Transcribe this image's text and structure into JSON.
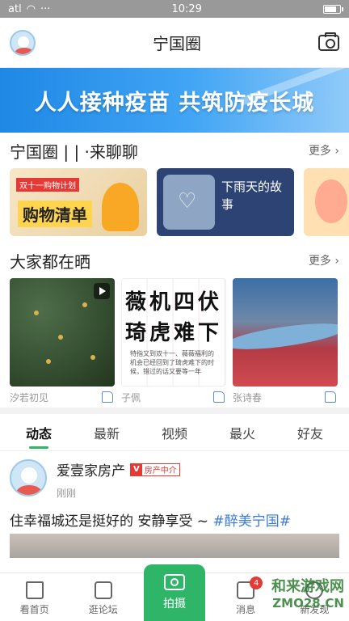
{
  "status_bar": {
    "time": "10:29",
    "signal": "atl",
    "wifi": "wifi-icon",
    "dots": "···"
  },
  "header": {
    "title": "宁国圈",
    "avatar_icon": "avatar-icon",
    "camera_icon": "camera-icon"
  },
  "banner": {
    "text": "人人接种疫苗  共筑防疫长城"
  },
  "section1": {
    "title": "宁国圈 | | ·来聊聊",
    "more": "更多",
    "cards": [
      {
        "tag": "双十一购物计划",
        "title": "购物清单"
      },
      {
        "poem": "下雨天的故事"
      },
      {
        "title": ""
      }
    ]
  },
  "section2": {
    "title": "大家都在晒",
    "more": "更多",
    "cards": [
      {
        "author": "汐若初见"
      },
      {
        "author": "子佩",
        "line1": "薇机四伏",
        "line2": "琦虎难下",
        "small": "特指又到双十一、薇薇福利的机会已经回到了琦虎难下的时候，错过的话又要等一年"
      },
      {
        "author": "张诗春"
      }
    ]
  },
  "tabs": [
    "动态",
    "最新",
    "视频",
    "最火",
    "好友"
  ],
  "active_tab": "动态",
  "post": {
    "author": "爱壹家房产",
    "badge_v": "V",
    "badge_label": "房产中介",
    "time": "刚刚",
    "text": "住幸福城还是挺好的 安静享受 ~ ",
    "hashtag": "#醉美宁国#"
  },
  "bottom_nav": {
    "home": "看首页",
    "forum": "逛论坛",
    "shoot": "拍摄",
    "messages": "消息",
    "messages_badge": "4",
    "discover": "新发现"
  },
  "watermark": {
    "line1": "和来游戏网",
    "line2": "ZMO28.CN"
  },
  "colors": {
    "accent": "#2fb567",
    "banner": "#1e88e5",
    "hashtag": "#3a7bd5",
    "badge": "#e53935"
  }
}
